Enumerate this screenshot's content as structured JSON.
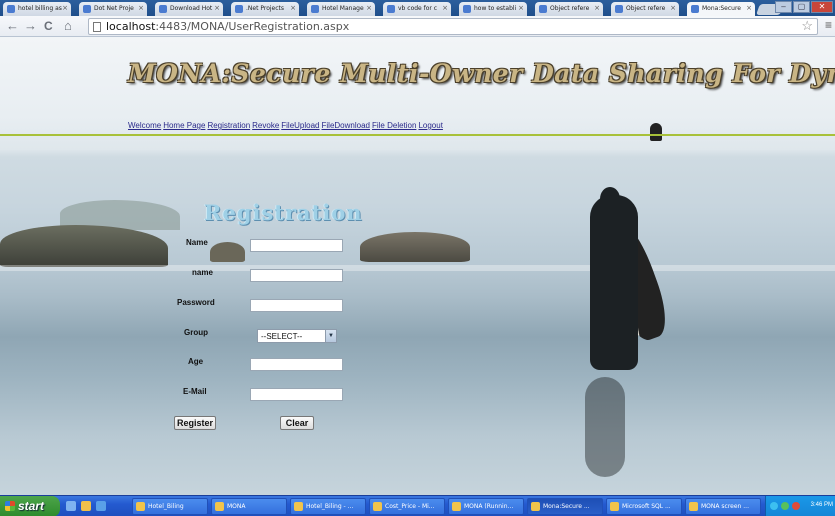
{
  "browser": {
    "tabs": [
      {
        "label": "hotel billing as",
        "active": false
      },
      {
        "label": "Dot Net Proje",
        "active": false
      },
      {
        "label": "Download Hot",
        "active": false
      },
      {
        "label": ".Net Projects",
        "active": false
      },
      {
        "label": "Hotel Manage",
        "active": false
      },
      {
        "label": "vb code for c",
        "active": false
      },
      {
        "label": "how to establi",
        "active": false
      },
      {
        "label": "Object refere",
        "active": false
      },
      {
        "label": "Object refere",
        "active": false
      },
      {
        "label": "Mona:Secure",
        "active": true
      }
    ],
    "url_host": "localhost",
    "url_rest": ":4483/MONA/UserRegistration.aspx",
    "tab_close_glyph": "×",
    "nav": {
      "back": "←",
      "forward": "→",
      "reload": "C",
      "home": "⌂"
    },
    "star_glyph": "☆",
    "menu_glyph": "≡",
    "window_buttons": {
      "minimize": "–",
      "maximize": "▢",
      "close": "✕"
    }
  },
  "site": {
    "title": "MONA:Secure Multi-Owner Data Sharing For Dynamic Groups in Cloud",
    "nav_links": [
      "Welcome",
      "Home Page",
      "Registration",
      "Revoke",
      "FileUpload",
      "FileDownload",
      "File Deletion",
      "Logout"
    ]
  },
  "form": {
    "heading": "Registration",
    "labels": {
      "name": "Name",
      "lastname": "name",
      "password": "Password",
      "group": "Group",
      "age": "Age",
      "email": "E-Mail"
    },
    "values": {
      "name": "",
      "lastname": "",
      "password": "",
      "age": "",
      "email": ""
    },
    "group_selected": "--SELECT--",
    "select_arrow_glyph": "▼",
    "register_label": "Register",
    "clear_label": "Clear"
  },
  "taskbar": {
    "start_label": "start",
    "tasks": [
      {
        "label": "Hotel_Biling",
        "active": false
      },
      {
        "label": "MONA",
        "active": false
      },
      {
        "label": "Hotel_Biling - ...",
        "active": false
      },
      {
        "label": "Cost_Price - Mi...",
        "active": false
      },
      {
        "label": "MONA (Runnin...",
        "active": false
      },
      {
        "label": "Mona:Secure ...",
        "active": true
      },
      {
        "label": "Microsoft SQL ...",
        "active": false
      },
      {
        "label": "MONA screen ...",
        "active": false
      }
    ],
    "clock": "3:46 PM"
  },
  "colors": {
    "title_gold": "#c9b585",
    "link_blue": "#2a2a8a",
    "rule_green": "#a8c13a",
    "heading_blue": "#9fd0e6",
    "taskbar_blue": "#245ad0",
    "start_green": "#3a9a38"
  }
}
